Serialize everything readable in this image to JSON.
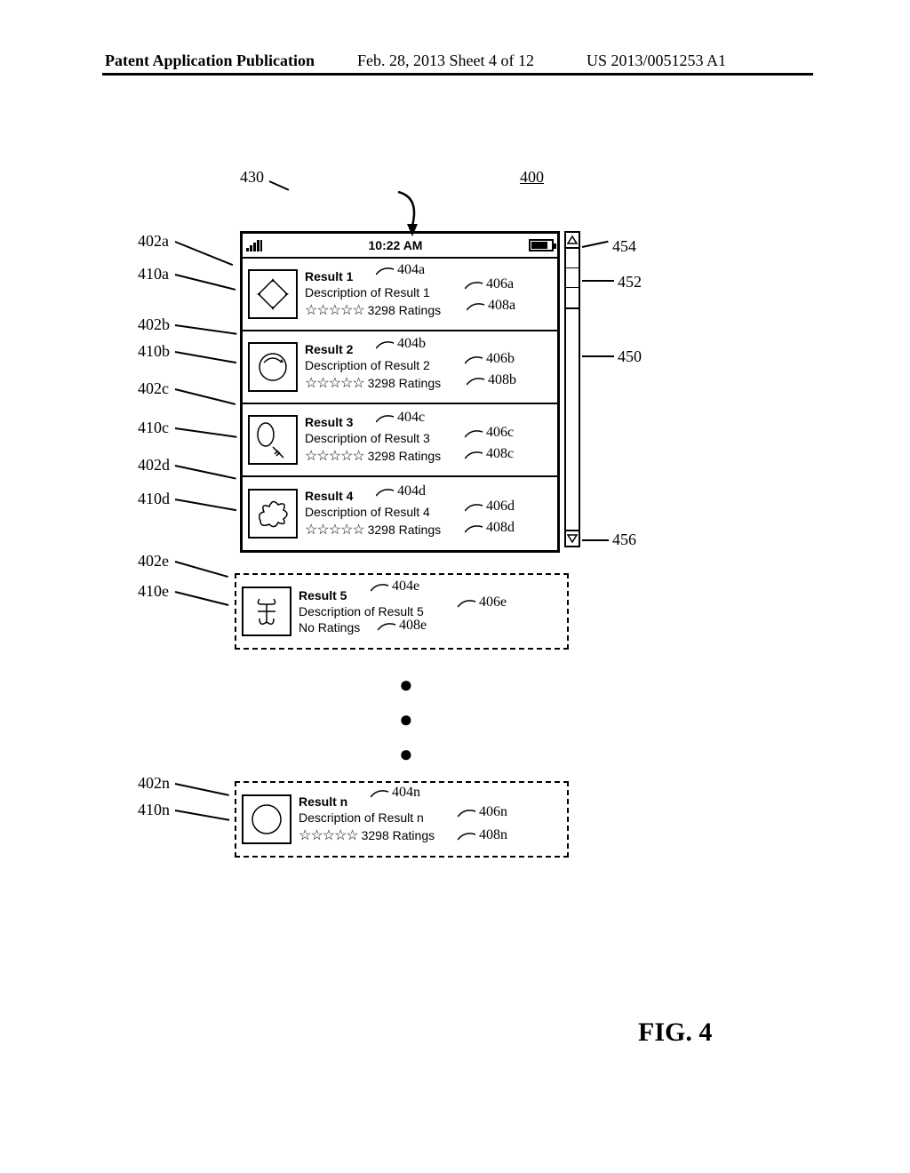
{
  "header": {
    "left": "Patent Application Publication",
    "center": "Feb. 28, 2013  Sheet 4 of 12",
    "right": "US 2013/0051253 A1"
  },
  "fig_label": "FIG. 4",
  "statusbar": {
    "time": "10:22 AM"
  },
  "rows": {
    "a": {
      "title": "Result 1",
      "desc": "Description of Result 1",
      "rating": "3298 Ratings",
      "stars": "☆☆☆☆☆"
    },
    "b": {
      "title": "Result 2",
      "desc": "Description of Result 2",
      "rating": "3298 Ratings",
      "stars": "☆☆☆☆☆"
    },
    "c": {
      "title": "Result 3",
      "desc": "Description of Result 3",
      "rating": "3298 Ratings",
      "stars": "☆☆☆☆☆"
    },
    "d": {
      "title": "Result 4",
      "desc": "Description of Result 4",
      "rating": "3298 Ratings",
      "stars": "☆☆☆☆☆"
    },
    "e": {
      "title": "Result 5",
      "desc": "Description of Result 5",
      "rating": "No Ratings"
    },
    "n": {
      "title": "Result n",
      "desc": "Description of Result n",
      "rating": "3298 Ratings",
      "stars": "☆☆☆☆☆"
    }
  },
  "refs": {
    "r400": "400",
    "r430": "430",
    "r402a": "402a",
    "r404a": "404a",
    "r406a": "406a",
    "r408a": "408a",
    "r410a": "410a",
    "r402b": "402b",
    "r404b": "404b",
    "r406b": "406b",
    "r408b": "408b",
    "r410b": "410b",
    "r402c": "402c",
    "r404c": "404c",
    "r406c": "406c",
    "r408c": "408c",
    "r410c": "410c",
    "r402d": "402d",
    "r404d": "404d",
    "r406d": "406d",
    "r408d": "408d",
    "r410d": "410d",
    "r402e": "402e",
    "r404e": "404e",
    "r406e_for_e": "406e",
    "r408e": "408e",
    "r410e": "410e",
    "r402n": "402n",
    "r404n": "404n",
    "r406n": "406n",
    "r408n": "408n",
    "r410n": "410n",
    "r450": "450",
    "r452": "452",
    "r454": "454",
    "r456": "456"
  }
}
